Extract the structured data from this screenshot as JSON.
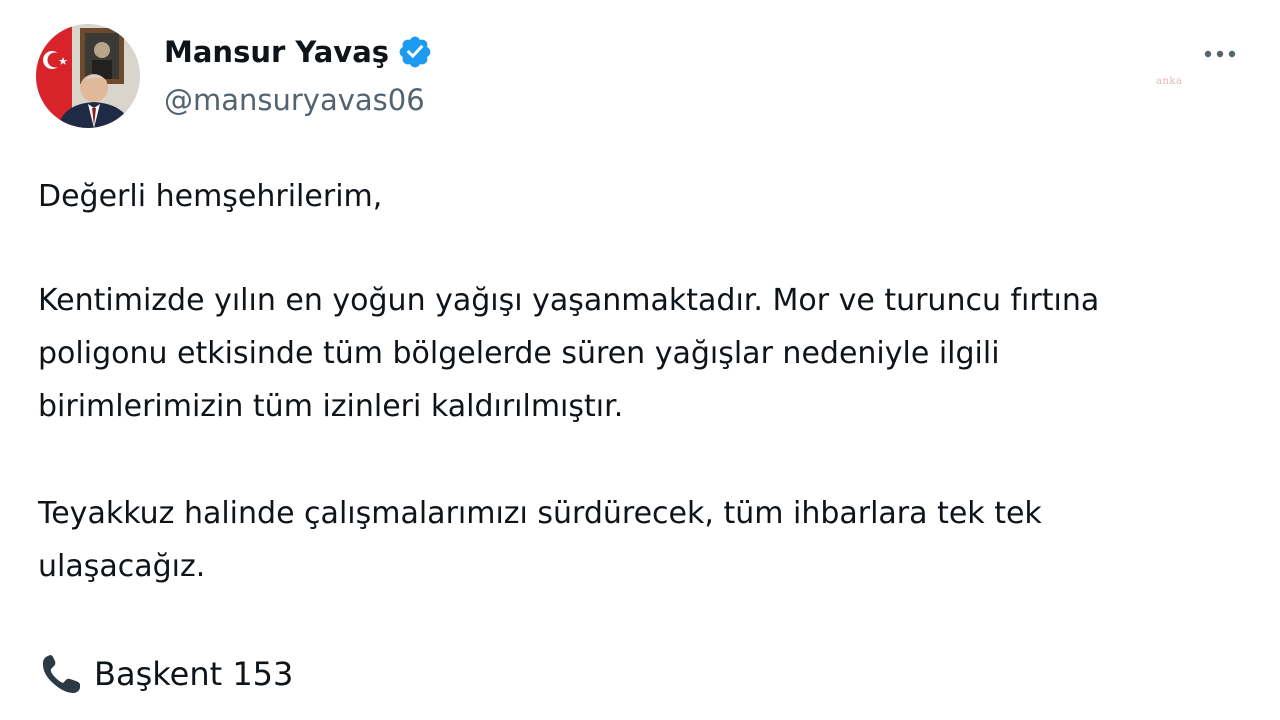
{
  "author": {
    "display_name": "Mansur Yavaş",
    "handle": "@mansuryavas06",
    "verified": true,
    "verified_color": "#1d9bf0"
  },
  "watermark": "anka",
  "tweet": {
    "paragraph_1": "Değerli hemşehrilerim,",
    "paragraph_2": "Kentimizde yılın en yoğun yağışı yaşanmaktadır. Mor ve turuncu fırtına\npoligonu etkisinde tüm bölgelerde süren yağışlar nedeniyle ilgili\nbirimlerimizin tüm izinleri kaldırılmıştır.",
    "paragraph_3": "Teyakkuz halinde çalışmalarımızı sürdürecek, tüm ihbarlara tek tek\nulaşacağız.",
    "contact_label": "Başkent 153"
  },
  "icons": {
    "avatar": "profile-photo",
    "verified": "verified-badge-icon",
    "more": "more-options-icon",
    "phone": "telephone-receiver-icon"
  }
}
